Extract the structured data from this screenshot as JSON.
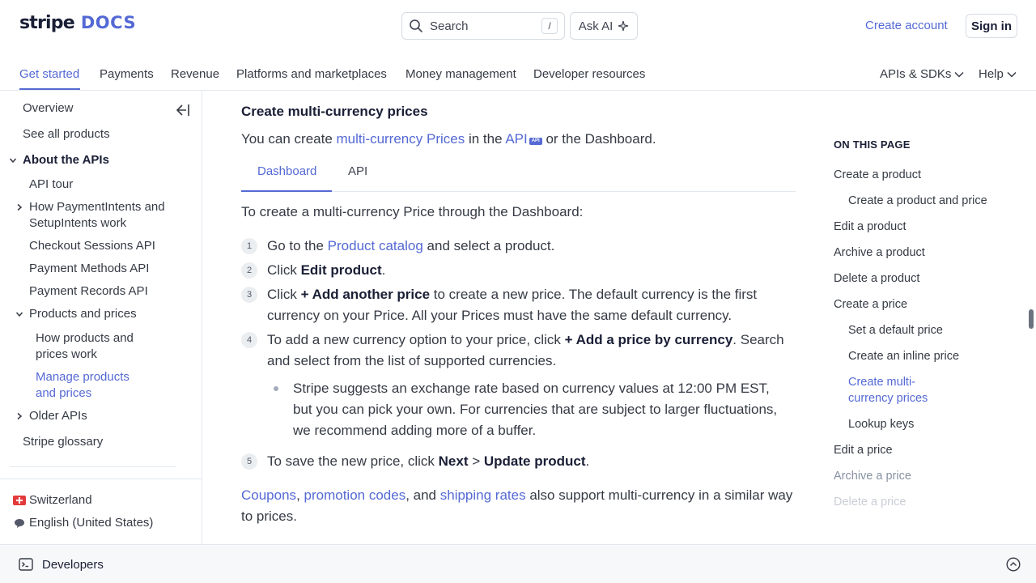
{
  "header": {
    "logo_stripe": "stripe",
    "logo_docs": "DOCS",
    "search_placeholder": "Search",
    "search_shortcut": "/",
    "ask_ai": "Ask AI",
    "create_account": "Create account",
    "sign_in": "Sign in"
  },
  "nav": {
    "items": [
      "Get started",
      "Payments",
      "Revenue",
      "Platforms and marketplaces",
      "Money management",
      "Developer resources"
    ],
    "right": [
      "APIs & SDKs",
      "Help"
    ]
  },
  "sidebar": {
    "overview": "Overview",
    "see_all": "See all products",
    "about_apis": "About the APIs",
    "api_tour": "API tour",
    "how_pi_1": "How PaymentIntents and",
    "how_pi_2": "SetupIntents work",
    "checkout": "Checkout Sessions API",
    "payment_methods": "Payment Methods API",
    "payment_records": "Payment Records API",
    "products_prices": "Products and prices",
    "how_products_1": "How products and",
    "how_products_2": "prices work",
    "manage_1": "Manage products",
    "manage_2": "and prices",
    "older_apis": "Older APIs",
    "glossary": "Stripe glossary",
    "country": "Switzerland",
    "language": "English (United States)"
  },
  "content": {
    "heading": "Create multi-currency prices",
    "intro_1": "You can create ",
    "intro_link1": "multi-currency Prices",
    "intro_2": " in the ",
    "intro_link2": "API",
    "intro_badge": "API",
    "intro_3": " or the Dashboard.",
    "tabs": [
      "Dashboard",
      "API"
    ],
    "lead": "To create a multi-currency Price through the Dashboard:",
    "steps": {
      "n1": "1",
      "n2": "2",
      "n3": "3",
      "n4": "4",
      "n5": "5",
      "s1_a": "Go to the ",
      "s1_link": "Product catalog",
      "s1_b": " and select a product.",
      "s2_a": "Click ",
      "s2_bold": "Edit product",
      "s2_b": ".",
      "s3_a": "Click ",
      "s3_bold": "+ Add another price",
      "s3_b": " to create a new price. The default currency is the first currency on your Price. All your Prices must have the same default currency.",
      "s4_a": "To add a new currency option to your price, click ",
      "s4_bold": "+ Add a price by currency",
      "s4_b": ". Search and select from the list of supported currencies.",
      "s4_bullet": "Stripe suggests an exchange rate based on currency values at 12:00 PM EST, but you can pick your own. For currencies that are subject to larger fluctuations, we recommend adding more of a buffer.",
      "s5_a": "To save the new price, click ",
      "s5_bold1": "Next",
      "s5_gt": " > ",
      "s5_bold2": "Update product",
      "s5_b": "."
    },
    "footer_link1": "Coupons",
    "footer_comma": ", ",
    "footer_link2": "promotion codes",
    "footer_and": ", and ",
    "footer_link3": "shipping rates",
    "footer_text": " also support multi-currency in a similar way to prices."
  },
  "toc": {
    "title": "ON THIS PAGE",
    "items": [
      "Create a product",
      "Create a product and price",
      "Edit a product",
      "Archive a product",
      "Delete a product",
      "Create a price",
      "Set a default price",
      "Create an inline price",
      "Create multi-",
      "currency prices",
      "Lookup keys",
      "Edit a price",
      "Archive a price",
      "Delete a price"
    ]
  },
  "footer": {
    "developers": "Developers"
  },
  "colors": {
    "accent": "#5469d4",
    "text": "#353a44",
    "heading": "#1a1f36"
  }
}
